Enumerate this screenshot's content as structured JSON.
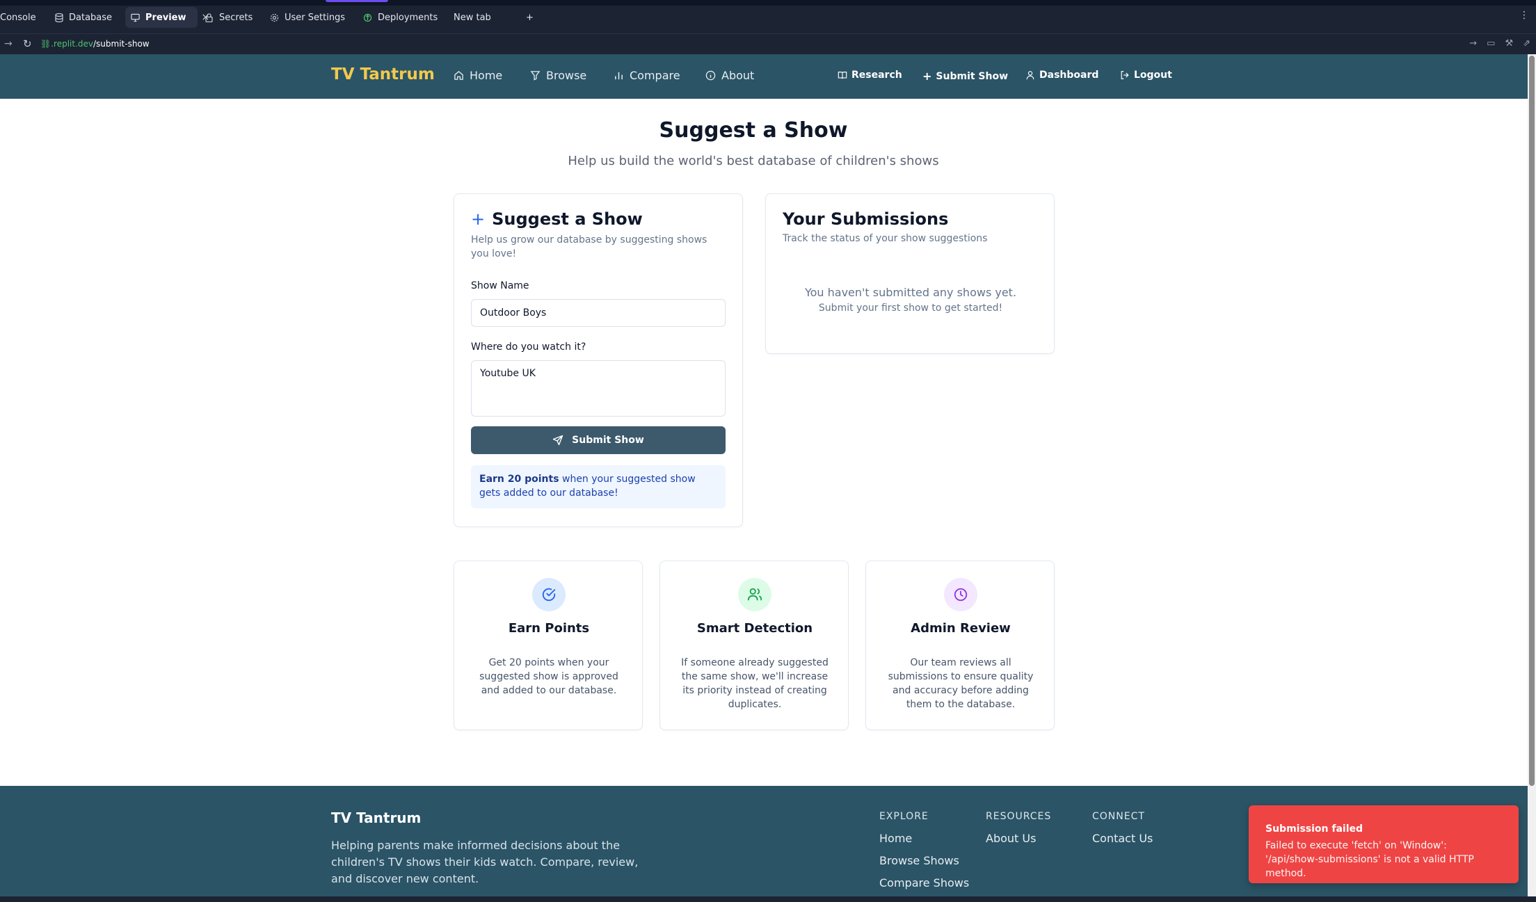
{
  "ide": {
    "tabs": [
      {
        "label": "Console",
        "icon": "console-icon"
      },
      {
        "label": "Database",
        "icon": "database-icon"
      },
      {
        "label": "Preview",
        "icon": "monitor-icon",
        "active": true
      },
      {
        "label": "Secrets",
        "icon": "lock-icon"
      },
      {
        "label": "User Settings",
        "icon": "gear-icon"
      },
      {
        "label": "Deployments",
        "icon": "deploy-icon"
      },
      {
        "label": "New tab",
        "icon": ""
      }
    ],
    "new_tab_glyph": "+",
    "close_glyph": "×",
    "more_glyph": "⋮"
  },
  "address": {
    "host": ".replit.dev",
    "path": "/submit-show"
  },
  "nav": {
    "brand": "TV Tantrum",
    "links": [
      "Home",
      "Browse",
      "Compare",
      "About"
    ],
    "right": [
      "Research",
      "Submit Show",
      "Dashboard",
      "Logout"
    ]
  },
  "page": {
    "title": "Suggest a Show",
    "subtitle": "Help us build the world's best database of children's shows"
  },
  "form": {
    "title": "Suggest a Show",
    "description": "Help us grow our database by suggesting shows you love!",
    "show_name_label": "Show Name",
    "show_name_value": "Outdoor Boys",
    "where_label": "Where do you watch it?",
    "where_value": "Youtube UK",
    "submit_label": "Submit Show",
    "points_bold": "Earn 20 points",
    "points_rest": " when your suggested show gets added to our database!"
  },
  "submissions": {
    "title": "Your Submissions",
    "description": "Track the status of your show suggestions",
    "empty_title": "You haven't submitted any shows yet.",
    "empty_sub": "Submit your first show to get started!"
  },
  "features": [
    {
      "title": "Earn Points",
      "desc": "Get 20 points when your suggested show is approved and added to our database.",
      "icon": "check-circle-icon",
      "bg": "#dbeafe",
      "fg": "#2563eb"
    },
    {
      "title": "Smart Detection",
      "desc": "If someone already suggested the same show, we'll increase its priority instead of creating duplicates.",
      "icon": "users-icon",
      "bg": "#dcfce7",
      "fg": "#16a34a"
    },
    {
      "title": "Admin Review",
      "desc": "Our team reviews all submissions to ensure quality and accuracy before adding them to the database.",
      "icon": "clock-icon",
      "bg": "#f3e8ff",
      "fg": "#9333ea"
    }
  ],
  "footer": {
    "brand": "TV Tantrum",
    "tagline": "Helping parents make informed decisions about the children's TV shows their kids watch. Compare, review, and discover new content.",
    "columns": [
      {
        "heading": "EXPLORE",
        "links": [
          "Home",
          "Browse Shows",
          "Compare Shows"
        ]
      },
      {
        "heading": "RESOURCES",
        "links": [
          "About Us"
        ]
      },
      {
        "heading": "CONNECT",
        "links": [
          "Contact Us"
        ]
      }
    ]
  },
  "toast": {
    "title": "Submission failed",
    "message": "Failed to execute 'fetch' on 'Window': '/api/show-submissions' is not a valid HTTP method."
  },
  "colors": {
    "nav_bg": "#2b5466",
    "brand_yellow": "#f2c94c",
    "button_bg": "#3c5a6c",
    "toast_bg": "#ef4444"
  }
}
